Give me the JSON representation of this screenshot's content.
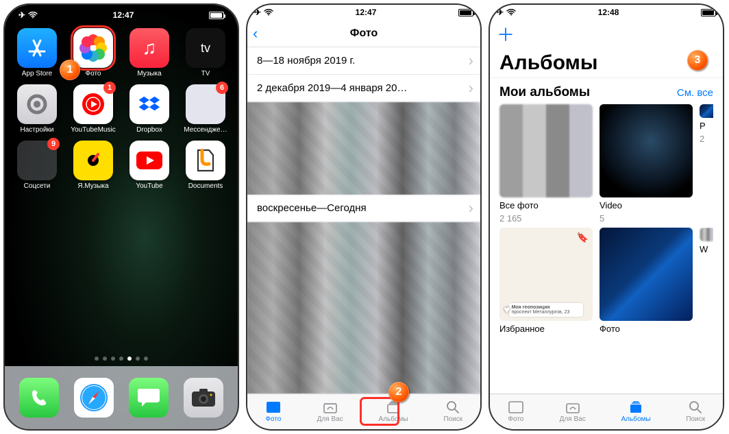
{
  "phone1": {
    "status": {
      "time": "12:47"
    },
    "apps": [
      {
        "label": "App Store",
        "icon": "appstore"
      },
      {
        "label": "Фото",
        "icon": "photos",
        "highlight": true
      },
      {
        "label": "Музыка",
        "icon": "music"
      },
      {
        "label": "TV",
        "icon": "tv"
      },
      {
        "label": "Настройки",
        "icon": "settings"
      },
      {
        "label": "YouTubeMusic",
        "icon": "ytmusic",
        "badge": "1"
      },
      {
        "label": "Dropbox",
        "icon": "dropbox"
      },
      {
        "label": "Мессендже…",
        "icon": "messenger",
        "badge": "6"
      },
      {
        "label": "Соцсети",
        "icon": "folder",
        "badge": "9"
      },
      {
        "label": "Я.Музыка",
        "icon": "yamusic"
      },
      {
        "label": "YouTube",
        "icon": "youtube"
      },
      {
        "label": "Documents",
        "icon": "documents"
      }
    ],
    "dock": [
      {
        "icon": "phone"
      },
      {
        "icon": "safari"
      },
      {
        "icon": "messages"
      },
      {
        "icon": "camera"
      }
    ],
    "step": "1"
  },
  "phone2": {
    "status": {
      "time": "12:47"
    },
    "title": "Фото",
    "rows": [
      "8—18 ноября 2019 г.",
      "2 декабря 2019—4 января 20…",
      "воскресенье—Сегодня"
    ],
    "tabs": {
      "photos": "Фото",
      "foryou": "Для Вас",
      "albums": "Альбомы",
      "search": "Поиск"
    },
    "step": "2"
  },
  "phone3": {
    "status": {
      "time": "12:48"
    },
    "title": "Альбомы",
    "section_my": "Мои альбомы",
    "see_all": "См. все",
    "albums": [
      {
        "name": "Все фото",
        "count": "2 165",
        "thumb": "mosaic"
      },
      {
        "name": "Video",
        "count": "5",
        "thumb": "earth"
      },
      {
        "name": "Р",
        "count": "2",
        "thumb": "cpu"
      },
      {
        "name": "Избранное",
        "count": "",
        "thumb": "map",
        "map_title": "Моя геопозиция",
        "map_sub": "проспект Металлургов, 23"
      },
      {
        "name": "Фото",
        "count": "",
        "thumb": "cpu"
      },
      {
        "name": "W",
        "count": "",
        "thumb": "mosaic"
      }
    ],
    "tabs": {
      "photos": "Фото",
      "foryou": "Для Вас",
      "albums": "Альбомы",
      "search": "Поиск"
    },
    "step": "3"
  }
}
